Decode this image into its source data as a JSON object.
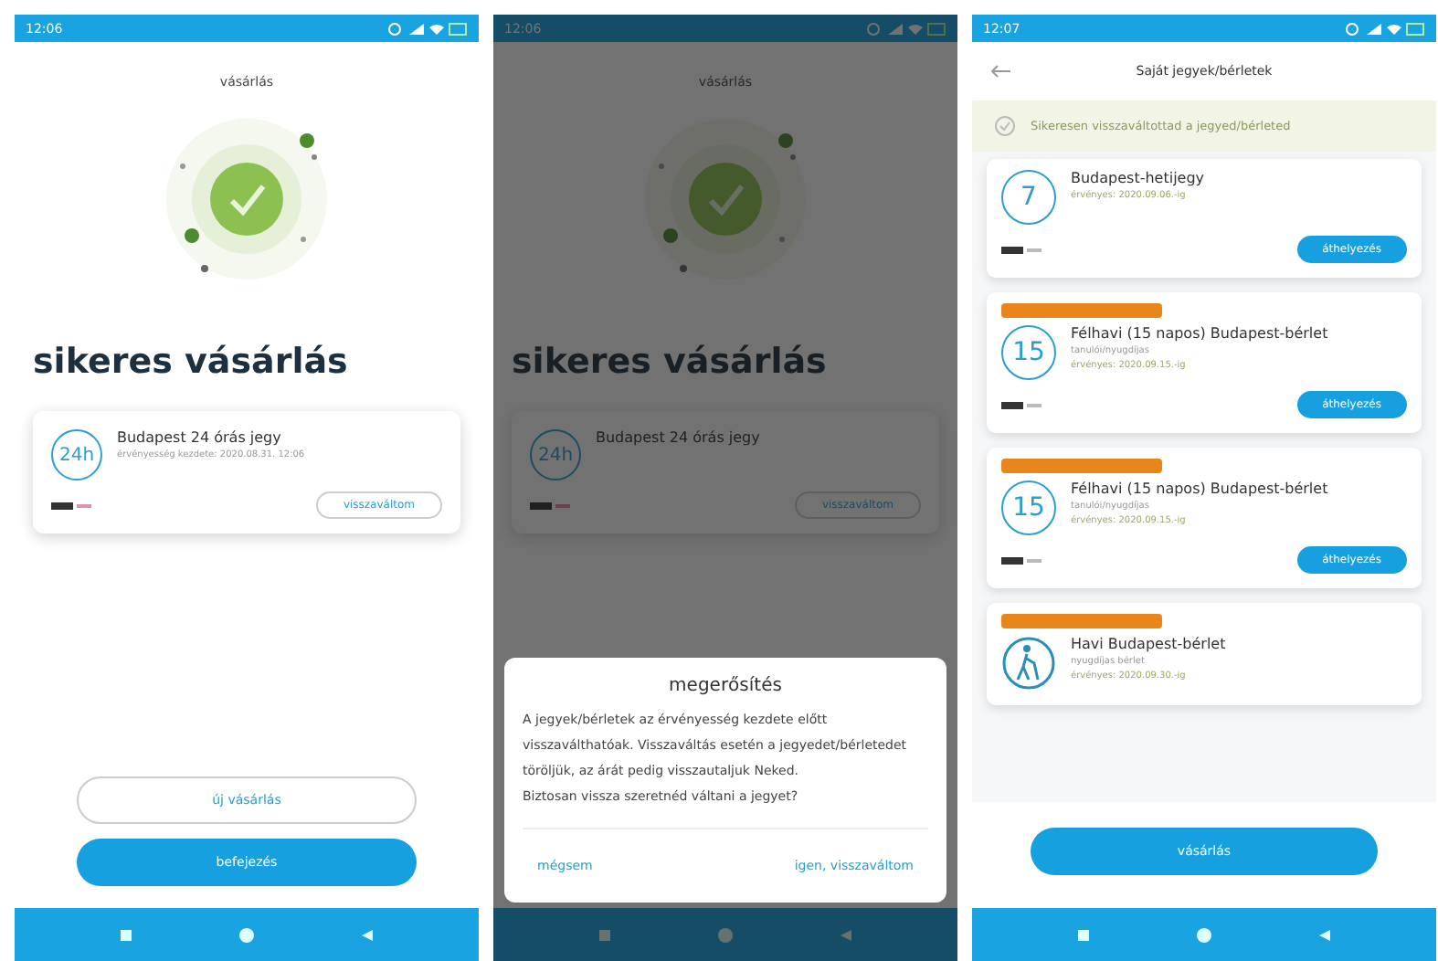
{
  "phones": [
    {
      "kind": "purchase",
      "status_time": "12:06",
      "title": "vásárlás",
      "heading": "sikeres vásárlás",
      "ticket": {
        "icon": "24h",
        "name": "Budapest 24 órás jegy",
        "detail": "érvényesség kezdete: 2020.08.31. 12:06",
        "action": "visszaváltom"
      },
      "buttons": [
        {
          "label": "új vásárlás",
          "kind": "outline"
        },
        {
          "label": "befejezés",
          "kind": "filled"
        }
      ]
    },
    {
      "kind": "purchase",
      "status_time": "12:06",
      "title": "vásárlás",
      "heading": "sikeres vásárlás",
      "ticket": {
        "icon": "24h",
        "name": "Budapest 24 órás jegy",
        "action": "visszaváltom"
      },
      "dialog": {
        "title": "megerősítés",
        "body": "A jegyek/bérletek az érvényesség kezdete előtt visszaválthatóak. Visszaváltás esetén a jegyedet/bérletedet töröljük, az árát pedig visszautaljuk Neked.",
        "question": "Biztosan vissza szeretnéd váltani a jegyet?",
        "buttons": [
          "mégsem",
          "igen, visszaváltom"
        ]
      }
    },
    {
      "kind": "tickets",
      "status_time": "12:07",
      "title": "Saját jegyek/bérletek",
      "notice": "Sikeresen visszaváltottad a jegyed/bérleted",
      "tickets": [
        {
          "kind": "text",
          "icon": "7",
          "badge": false,
          "name": "Budapest-hetijegy",
          "validity": "érvényes: 2020.09.06.-ig",
          "action": "áthelyezés"
        },
        {
          "kind": "text",
          "icon": "15",
          "badge": true,
          "name": "Félhavi (15 napos) Budapest-bérlet",
          "sub": "tanulói/nyugdíjas",
          "validity": "érvényes: 2020.09.15.-ig",
          "action": "áthelyezés"
        },
        {
          "kind": "text",
          "icon": "15",
          "badge": true,
          "name": "Félhavi (15 napos) Budapest-bérlet",
          "sub": "tanulói/nyugdíjas",
          "validity": "érvényes: 2020.09.15.-ig",
          "action": "áthelyezés"
        },
        {
          "kind": "walker",
          "badge": true,
          "name": "Havi Budapest-bérlet",
          "sub": "nyugdíjas bérlet",
          "validity": "érvényes: 2020.09.30.-ig"
        }
      ],
      "button": "vásárlás"
    }
  ]
}
